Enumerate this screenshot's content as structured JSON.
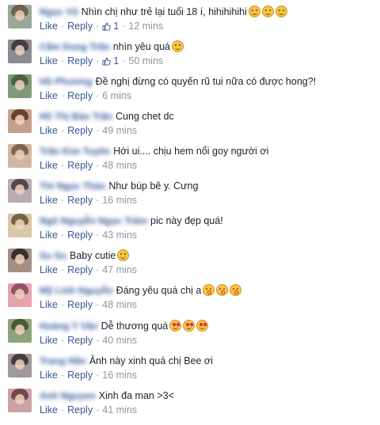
{
  "labels": {
    "like": "Like",
    "reply": "Reply",
    "dot": "·"
  },
  "colors": {
    "link": "#365899",
    "meta": "#90949c",
    "text": "#1d2129"
  },
  "comments": [
    {
      "name": "Ngọc Vũ",
      "text": "Nhìn chị như trẻ lại tuổi 18 í, hihihihihi",
      "emoji": [
        "smile-icon",
        "smile-icon",
        "smile-icon"
      ],
      "likes": "1",
      "time": "12 mins",
      "avatar": [
        "#9aa79a",
        "#6d5a4a"
      ]
    },
    {
      "name": "Cẩm Dung Trần",
      "text": "nhìn yêu quá",
      "emoji": [
        "smile-icon"
      ],
      "likes": "1",
      "time": "50 mins",
      "avatar": [
        "#8b8b92",
        "#3a3440"
      ]
    },
    {
      "name": "Hồ Phương",
      "text": "Đề nghị đừng có quyến rũ tui nữa có được hong?!",
      "emoji": [],
      "likes": "",
      "time": "6 mins",
      "avatar": [
        "#7f9a7a",
        "#4a5c3a"
      ]
    },
    {
      "name": "Hồ Thị Bảo Trân",
      "text": "Cung chet dc",
      "emoji": [],
      "likes": "",
      "time": "49 mins",
      "avatar": [
        "#c7a08a",
        "#5a3a2a"
      ]
    },
    {
      "name": "Trần Kim Tuyền",
      "text": "Hới ui.... chịu hem nổi goy người ơi",
      "emoji": [],
      "likes": "",
      "time": "48 mins",
      "avatar": [
        "#d1b7a3",
        "#7a5a44"
      ]
    },
    {
      "name": "Thi Ngọc Thảo",
      "text": "Như búp bê y. Cưng",
      "emoji": [],
      "likes": "",
      "time": "16 mins",
      "avatar": [
        "#b9aab0",
        "#4a3a42"
      ]
    },
    {
      "name": "Ngô Nguyễn Ngọc Trâm",
      "text": "pic này đẹp quá!",
      "emoji": [],
      "likes": "",
      "time": "43 mins",
      "avatar": [
        "#d8c7a8",
        "#6b5838"
      ]
    },
    {
      "name": "Su Su",
      "text": "Baby cutie",
      "emoji": [
        "smile-icon"
      ],
      "likes": "",
      "time": "47 mins",
      "avatar": [
        "#a38f86",
        "#2e2522"
      ]
    },
    {
      "name": "Mỹ Linh Nguyễn",
      "text": "Đáng yêu quá chị a",
      "emoji": [
        "kiss-icon",
        "kiss-icon",
        "kiss-icon"
      ],
      "likes": "",
      "time": "48 mins",
      "avatar": [
        "#e3a3b0",
        "#8a4a5a"
      ]
    },
    {
      "name": "Hoàng Y Vân",
      "text": "Dễ thương quá",
      "emoji": [
        "heart-eyes-icon",
        "heart-eyes-icon",
        "heart-eyes-icon"
      ],
      "likes": "",
      "time": "40 mins",
      "avatar": [
        "#8fa37a",
        "#3f5230"
      ]
    },
    {
      "name": "Trang Hân",
      "text": "Ảnh này xinh quá chị Bee ơi",
      "emoji": [],
      "likes": "",
      "time": "16 mins",
      "avatar": [
        "#a09a9a",
        "#3c3232"
      ]
    },
    {
      "name": "Anh Nguyen",
      "text": "Xinh đa man >3<",
      "emoji": [],
      "likes": "",
      "time": "41 mins",
      "avatar": [
        "#c9a3a8",
        "#6a3c44"
      ]
    }
  ]
}
